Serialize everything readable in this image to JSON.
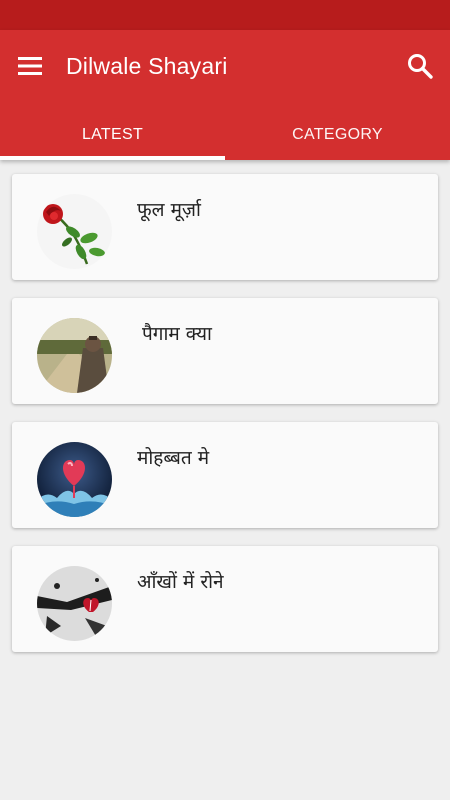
{
  "app": {
    "title": "Dilwale Shayari",
    "colors": {
      "primary": "#d32f2f",
      "primary_dark": "#b71c1c",
      "background": "#efefef"
    },
    "icons": {
      "menu": "hamburger-menu-icon",
      "search": "search-icon"
    }
  },
  "tabs": [
    {
      "label": "LATEST",
      "selected": true
    },
    {
      "label": "CATEGORY",
      "selected": false
    }
  ],
  "items": [
    {
      "title": "फूल मूर्ज़ा",
      "image": "red-rose"
    },
    {
      "title": "पैगाम क्या",
      "image": "man-on-path"
    },
    {
      "title": "मोहब्बत मे",
      "image": "heart-splash"
    },
    {
      "title": "आँखों में रोने",
      "image": "broken-heart"
    }
  ]
}
